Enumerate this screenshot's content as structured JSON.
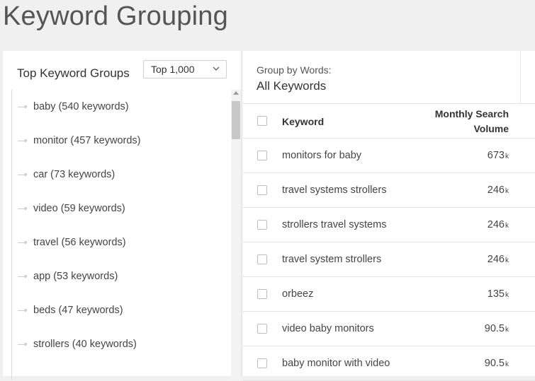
{
  "page": {
    "title": "Keyword Grouping"
  },
  "left_panel": {
    "title": "Top Keyword Groups",
    "select_value": "Top 1,000",
    "groups": [
      {
        "label": "baby (540 keywords)"
      },
      {
        "label": "monitor (457 keywords)"
      },
      {
        "label": "car (73 keywords)"
      },
      {
        "label": "video (59 keywords)"
      },
      {
        "label": "travel (56 keywords)"
      },
      {
        "label": "app (53 keywords)"
      },
      {
        "label": "beds (47 keywords)"
      },
      {
        "label": "strollers (40 keywords)"
      }
    ]
  },
  "right_panel": {
    "group_by_label": "Group by Words:",
    "group_by_value": "All Keywords",
    "columns": {
      "keyword": "Keyword",
      "volume_line1": "Monthly Search",
      "volume_line2": "Volume"
    },
    "rows": [
      {
        "keyword": "monitors for baby",
        "volume": "673",
        "unit": "k"
      },
      {
        "keyword": "travel systems strollers",
        "volume": "246",
        "unit": "k"
      },
      {
        "keyword": "strollers travel systems",
        "volume": "246",
        "unit": "k"
      },
      {
        "keyword": "travel system strollers",
        "volume": "246",
        "unit": "k"
      },
      {
        "keyword": "orbeez",
        "volume": "135",
        "unit": "k"
      },
      {
        "keyword": "video baby monitors",
        "volume": "90.5",
        "unit": "k"
      },
      {
        "keyword": "baby monitor with video",
        "volume": "90.5",
        "unit": "k"
      }
    ]
  },
  "colors": {
    "background": "#f0f0f0",
    "panel": "#ffffff",
    "border": "#e4e4e4"
  }
}
